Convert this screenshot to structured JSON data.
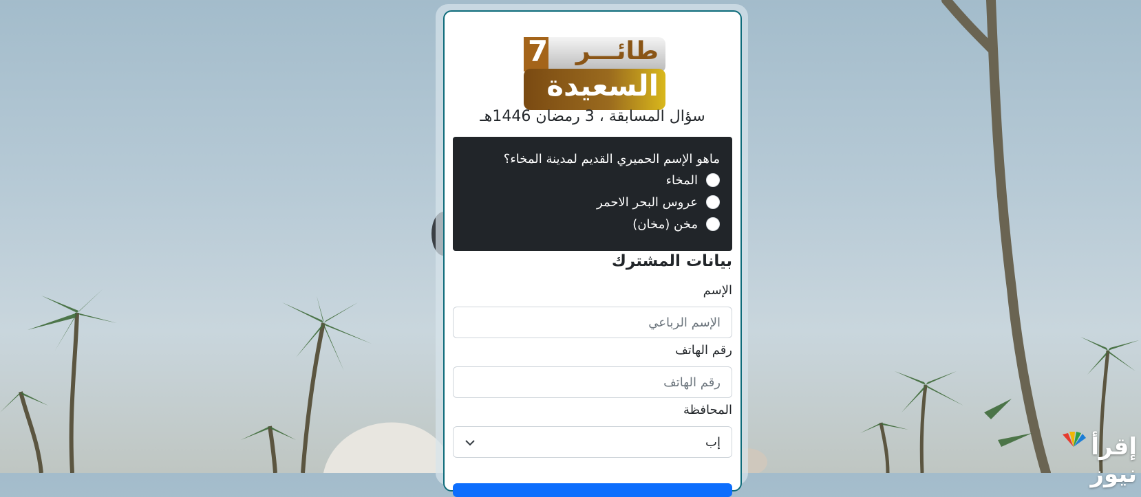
{
  "logo": {
    "number": "7",
    "line1": "طائـــر",
    "line2": "السعيدة"
  },
  "quiz": {
    "title": "سؤال المسابقة ، 3 رمضان 1446هـ",
    "question": "ماهو الإسم الحميري القديم لمدينة المخاء؟",
    "options": [
      "المخاء",
      "عروس البحر الاحمر",
      "مخن (مخان)"
    ]
  },
  "participant": {
    "heading": "بيانات المشترك",
    "name_label": "الإسم",
    "name_placeholder": "الإسم الرباعي",
    "phone_label": "رقم الهاتف",
    "phone_placeholder": "رقم الهاتف",
    "governorate_label": "المحافظة",
    "governorate_value": "إب"
  },
  "watermark": {
    "text": "إقرأ نيوز"
  },
  "colors": {
    "card_border": "#0d6b7a",
    "question_bg": "#212529",
    "submit": "#0d6efd",
    "logo_brown": "#7a4a12",
    "logo_gold": "#d9b81c"
  }
}
